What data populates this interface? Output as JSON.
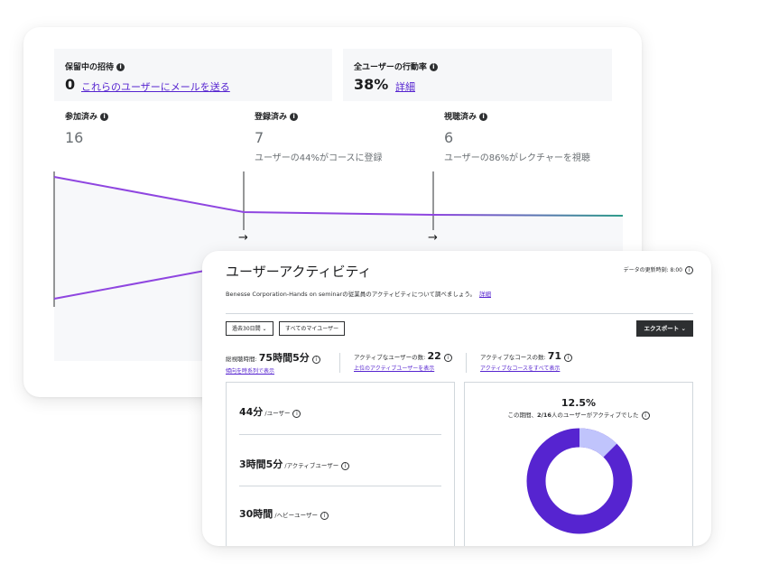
{
  "back_card": {
    "pending": {
      "label": "保留中の招待",
      "value": "0",
      "link": "これらのユーザーにメールを送る"
    },
    "engagement": {
      "label": "全ユーザーの行動率",
      "value": "38%",
      "link": "詳細"
    },
    "funnel": [
      {
        "label": "参加済み",
        "value": "16",
        "sub": ""
      },
      {
        "label": "登録済み",
        "value": "7",
        "sub": "ユーザーの44%がコースに登録"
      },
      {
        "label": "視聴済み",
        "value": "6",
        "sub": "ユーザーの86%がレクチャーを視聴"
      }
    ],
    "arrow": "→"
  },
  "front_card": {
    "title": "ユーザーアクティビティ",
    "updated": "データの更新時刻: 8:00",
    "description": "Benesse Corporation-Hands on seminarの従業員のアクティビティについて調べましょう。",
    "description_link": "詳細",
    "filters": {
      "period": "過去30日間 ⌄",
      "users": "すべてのマイユーザー"
    },
    "export": "エクスポート ⌄",
    "metrics": [
      {
        "label": "総視聴時間:",
        "value": "75時間5分",
        "link": "傾向を時系列で表示"
      },
      {
        "label": "アクティブなユーザーの数:",
        "value": "22",
        "link": "上位のアクティブユーザーを表示"
      },
      {
        "label": "アクティブなコースの数:",
        "value": "71",
        "link": "アクティブなコースをすべて表示"
      }
    ],
    "rows": [
      {
        "value": "44分",
        "unit": "/ユーザー"
      },
      {
        "value": "3時間5分",
        "unit": "/アクティブユーザー"
      },
      {
        "value": "30時間",
        "unit": "/ヘビーユーザー"
      }
    ],
    "donut": {
      "percent": "12.5%",
      "caption_prefix": "この期間、",
      "caption_count": "2/16",
      "caption_suffix": "人のユーザーがアクティブでした",
      "fraction": 0.125,
      "color_active": "#c0c4fc",
      "color_rest": "#5624d0"
    }
  },
  "info_glyph": "i",
  "colors": {
    "accent": "#5624d0",
    "line_purple": "#8f46e0",
    "line_teal": "#2e9c8a"
  }
}
